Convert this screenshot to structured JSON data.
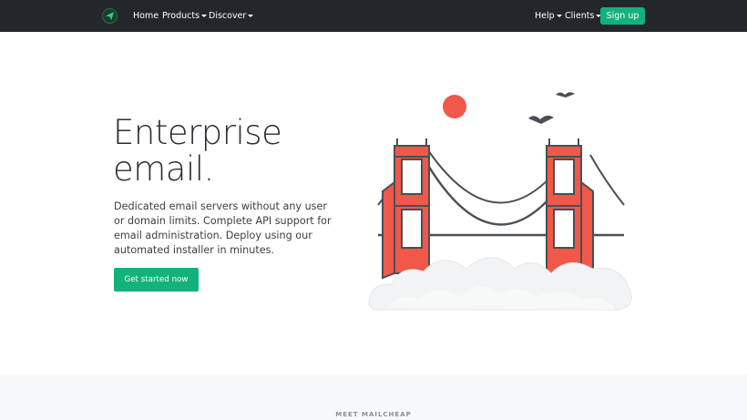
{
  "nav": {
    "logo_icon": "paper-plane-icon",
    "links": [
      {
        "label": "Home",
        "dropdown": false
      },
      {
        "label": "Products",
        "dropdown": true
      },
      {
        "label": "Discover",
        "dropdown": true
      }
    ],
    "right_links": [
      {
        "label": "Help",
        "dropdown": true
      },
      {
        "label": "Clients",
        "dropdown": true
      }
    ],
    "signup_label": "Sign up"
  },
  "hero": {
    "title_line1": "Enterprise",
    "title_line2": "email.",
    "description": "Dedicated email servers without any user or domain limits. Complete API support for email administration. Deploy using our automated installer in minutes.",
    "cta_label": "Get started now",
    "illustration_icon": "golden-gate-bridge-illustration"
  },
  "section": {
    "eyebrow": "MEET MAILCHEAP"
  },
  "colors": {
    "navbar_bg": "#23272b",
    "accent_green": "#13b27a",
    "bridge_red": "#f0584a",
    "sun_red": "#f0584a",
    "outline": "#4a4f55"
  }
}
